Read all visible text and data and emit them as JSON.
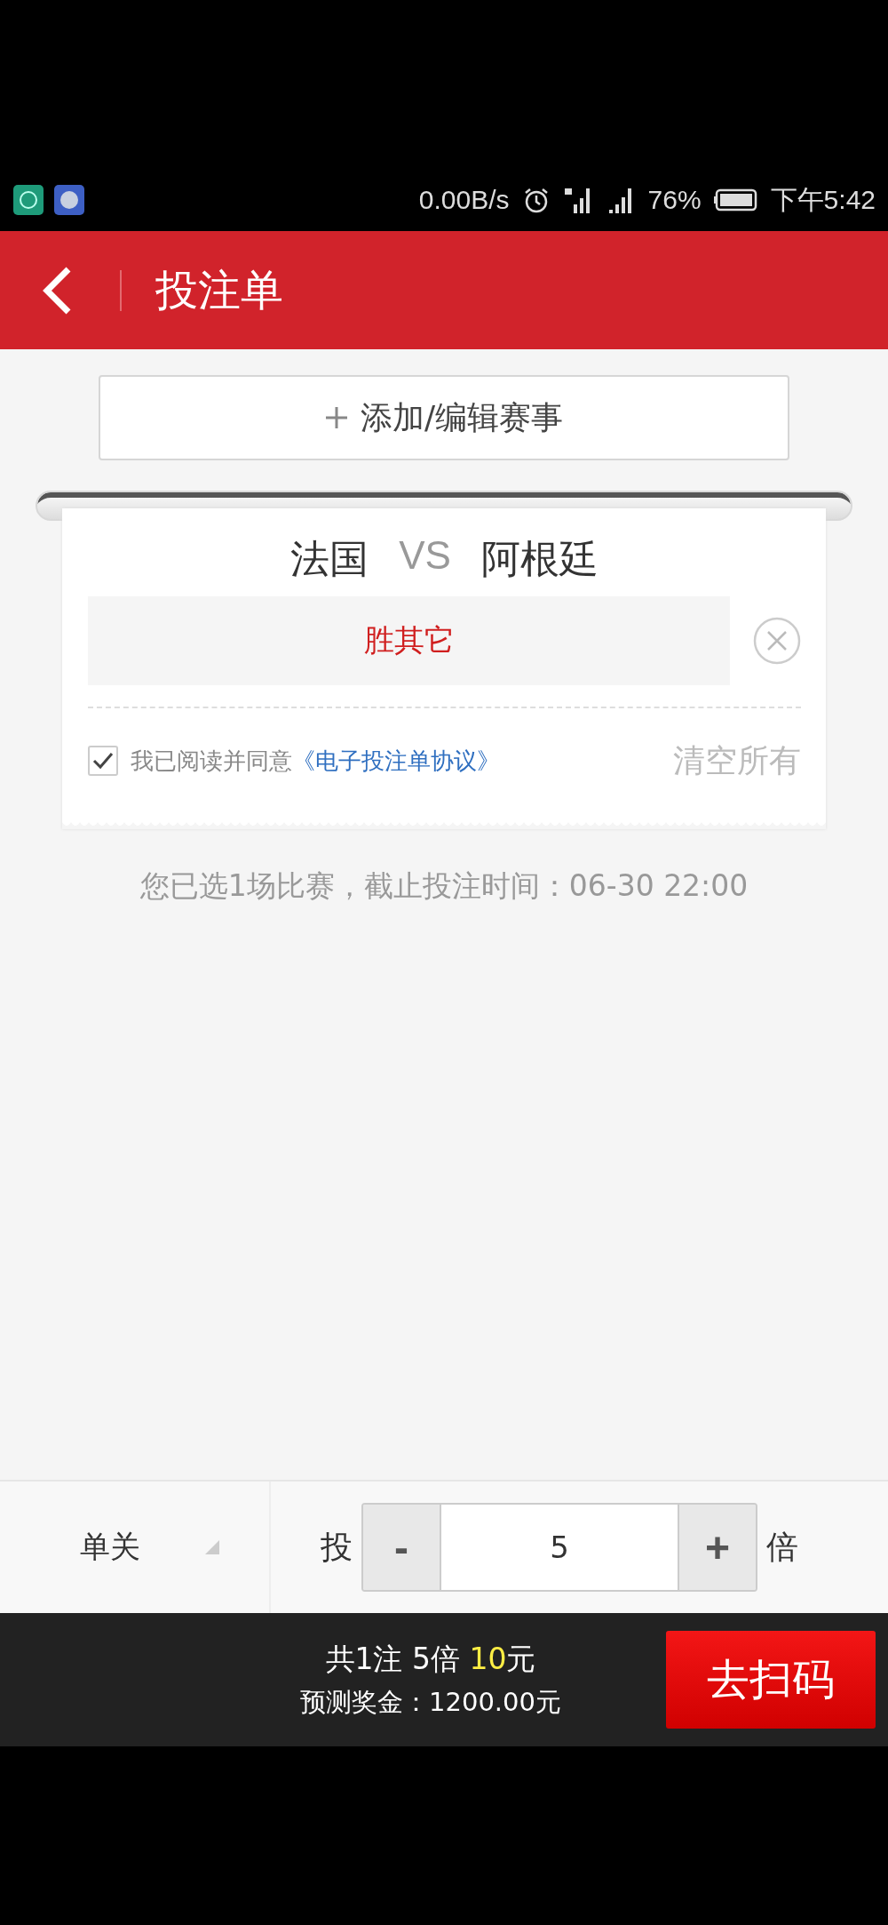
{
  "status_bar": {
    "net_speed": "0.00B/s",
    "battery": "76%",
    "time": "下午5:42"
  },
  "header": {
    "title": "投注单"
  },
  "add_button": {
    "label": "添加/编辑赛事"
  },
  "match": {
    "home": "法国",
    "vs": "VS",
    "away": "阿根廷"
  },
  "selections": [
    {
      "label": "胜其它"
    }
  ],
  "agreement": {
    "checked": true,
    "text": "我已阅读并同意",
    "link": "《电子投注单协议》"
  },
  "clear_all": "清空所有",
  "info": "您已选1场比赛，截止投注时间：06-30 22:00",
  "bet_type": {
    "label": "单关"
  },
  "multiplier": {
    "prefix": "投",
    "minus": "-",
    "value": "5",
    "plus": "+",
    "suffix": "倍"
  },
  "summary": {
    "count": "共1注",
    "times": "5倍",
    "amount": "10",
    "unit": "元",
    "prize": "预测奖金：1200.00元"
  },
  "scan_button": {
    "label": "去扫码"
  }
}
